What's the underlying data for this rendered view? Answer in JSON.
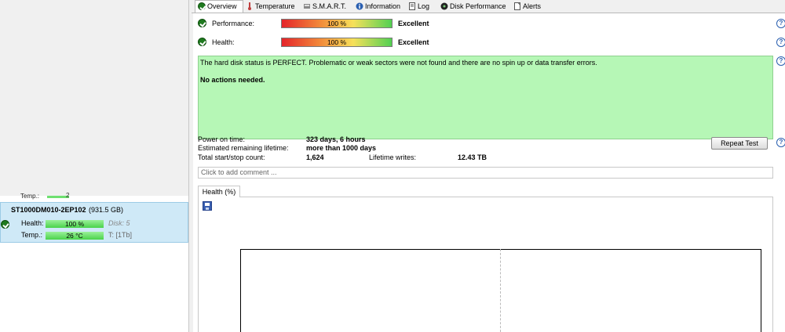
{
  "tabs": [
    {
      "label": "Overview",
      "icon": "check-circle-icon"
    },
    {
      "label": "Temperature",
      "icon": "thermometer-icon"
    },
    {
      "label": "S.M.A.R.T.",
      "icon": "smart-icon"
    },
    {
      "label": "Information",
      "icon": "info-icon"
    },
    {
      "label": "Log",
      "icon": "log-icon"
    },
    {
      "label": "Disk Performance",
      "icon": "disk-icon"
    },
    {
      "label": "Alerts",
      "icon": "alerts-icon"
    }
  ],
  "overview": {
    "performance": {
      "label": "Performance:",
      "value": "100 %",
      "level": 1.0,
      "rating": "Excellent"
    },
    "health": {
      "label": "Health:",
      "value": "100 %",
      "level": 1.0,
      "rating": "Excellent"
    },
    "status_text": "The hard disk status is PERFECT. Problematic or weak sectors were not found and there are no spin up or data transfer errors.",
    "actions_text": "No actions needed.",
    "stats": {
      "power_on_label": "Power on time:",
      "power_on_value": "323 days, 6 hours",
      "remaining_label": "Estimated remaining lifetime:",
      "remaining_value": "more than 1000 days",
      "start_stop_label": "Total start/stop count:",
      "start_stop_value": "1,624",
      "writes_label": "Lifetime writes:",
      "writes_value": "12.43 TB"
    },
    "repeat_button": "Repeat Test",
    "help_glyph": "?",
    "comment_placeholder": "Click to add comment ...",
    "chart_tab": "Health (%)"
  },
  "drive_list": {
    "prev_label": "Temp.:",
    "prev_value": "2",
    "drive": {
      "name": "ST1000DM010-2EP102",
      "size": "(931.5 GB)",
      "health_label": "Health:",
      "health_value": "100 %",
      "disk_label": "Disk: 5",
      "temp_label": "Temp.:",
      "temp_value": "26 °C",
      "t_label": "T: [1Tb]"
    }
  }
}
